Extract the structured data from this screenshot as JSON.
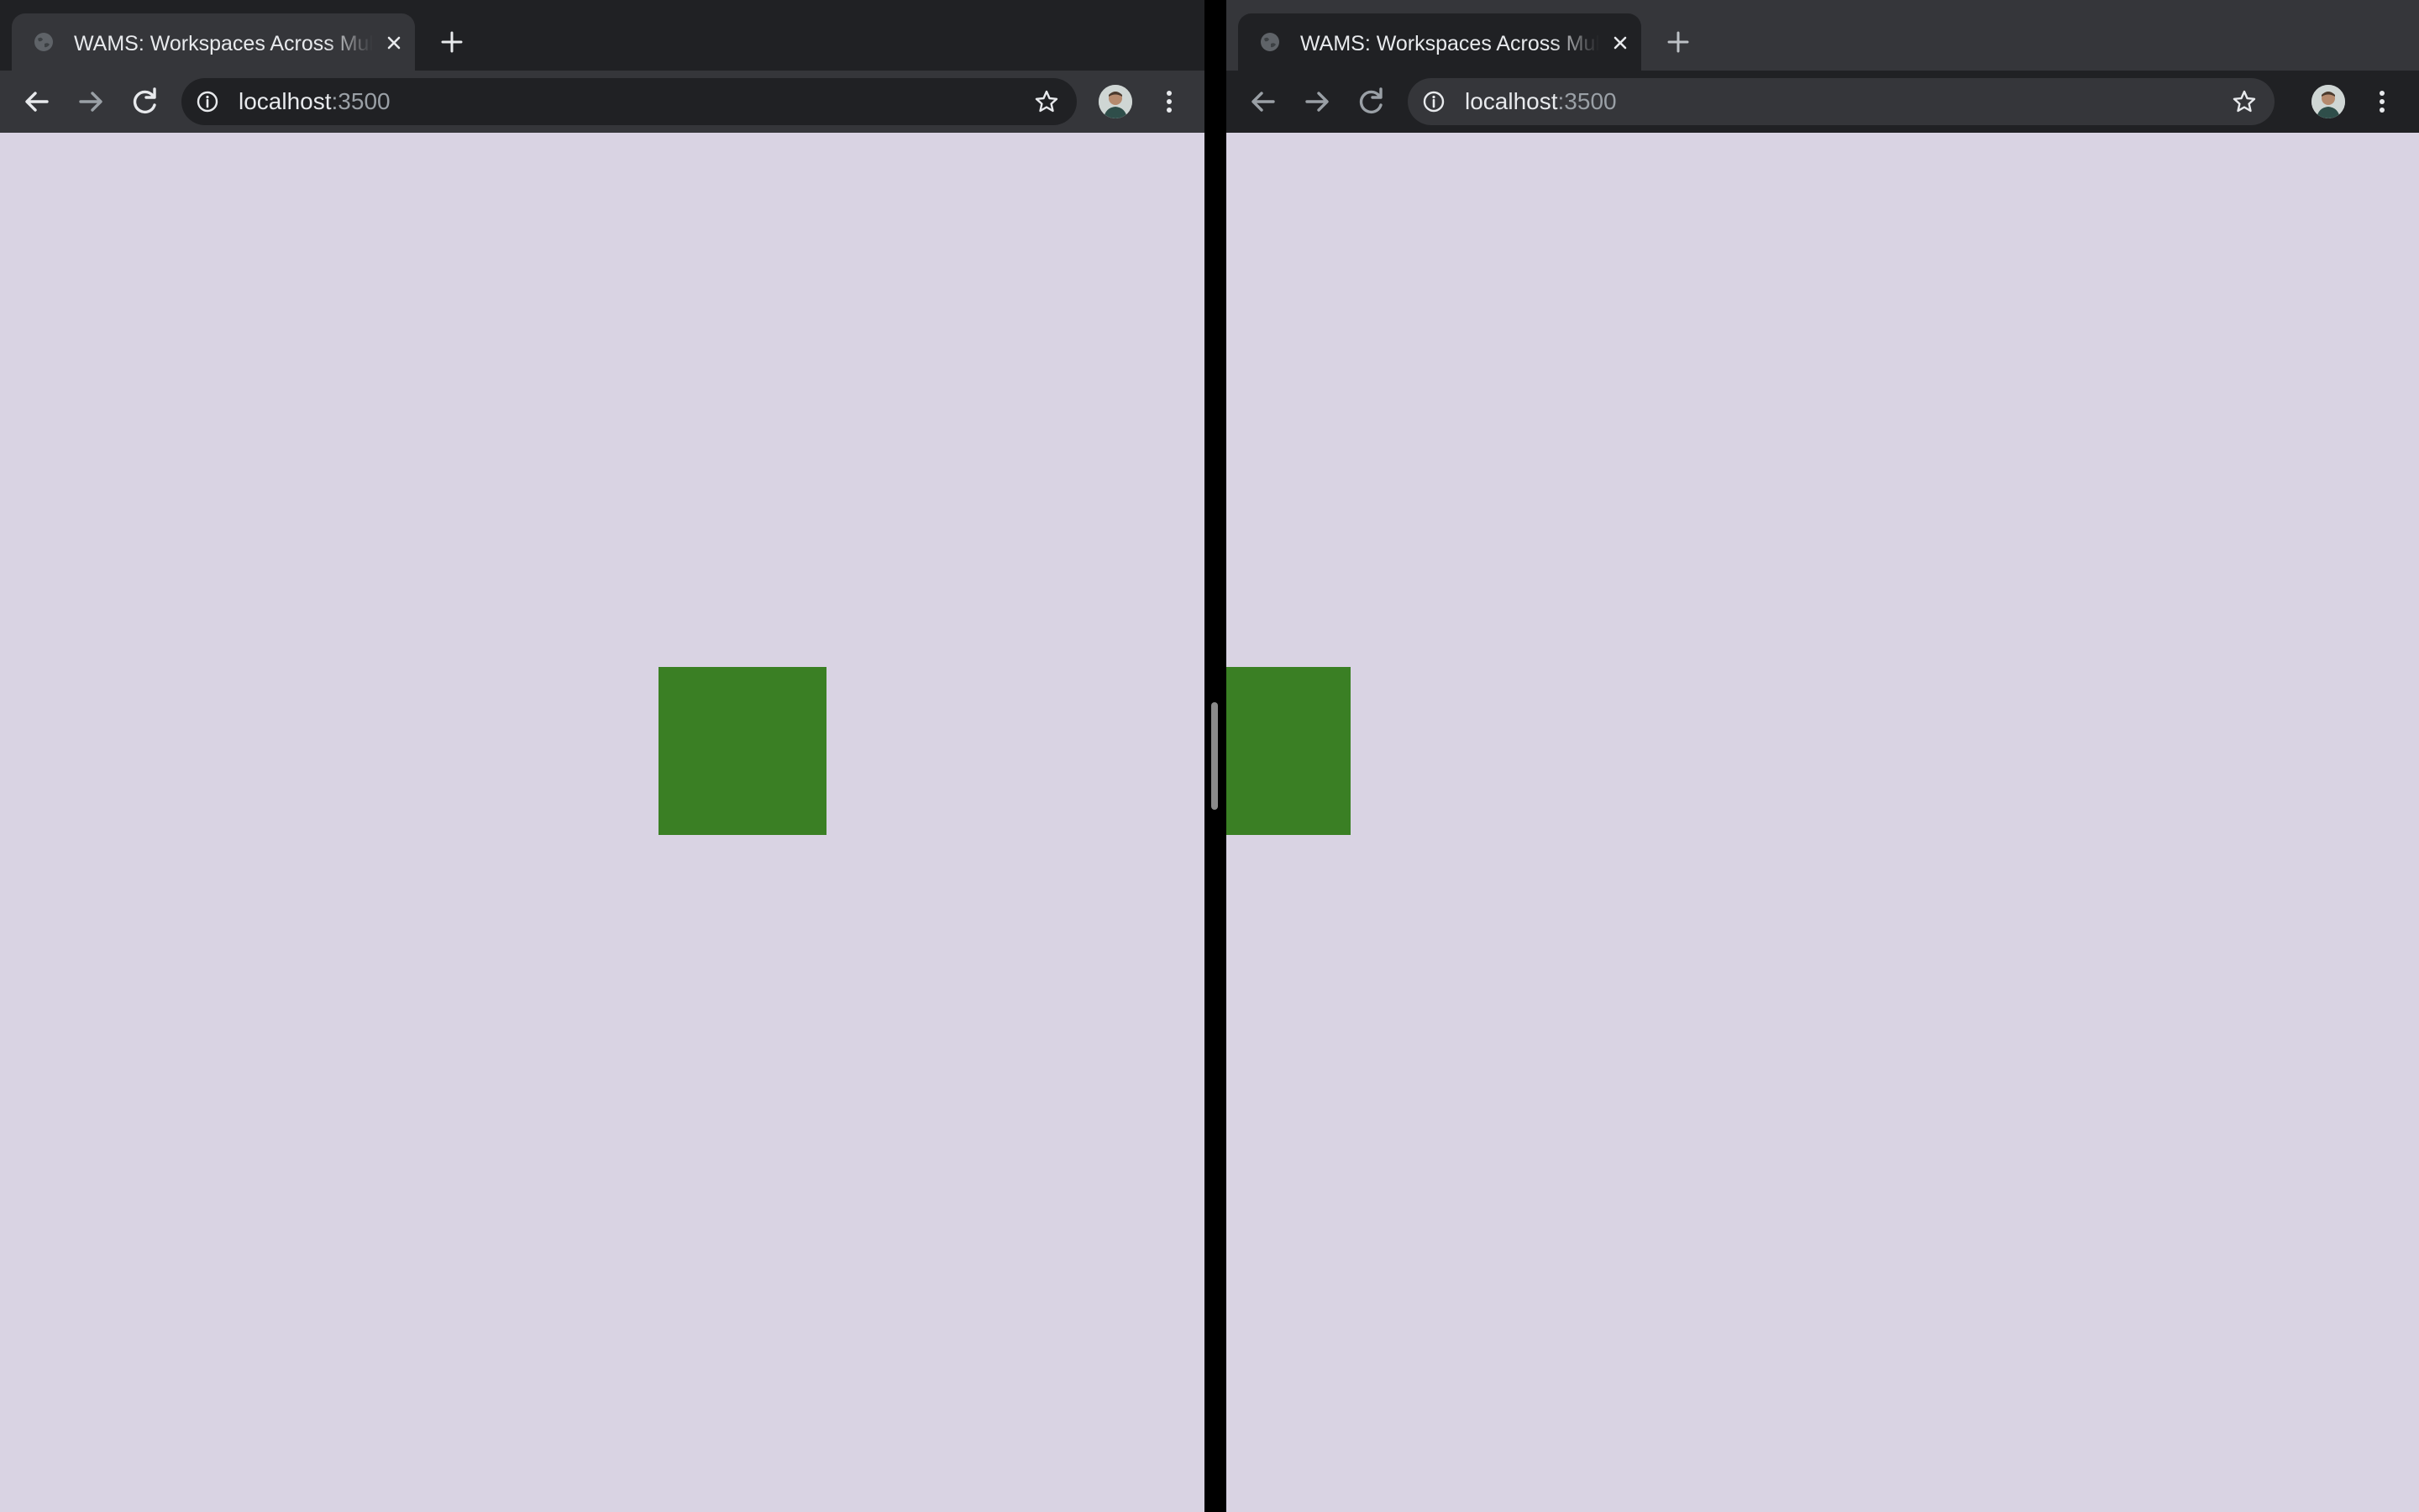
{
  "browsers": [
    {
      "tab": {
        "title": "WAMS: Workspaces Across Multiple Surfaces"
      },
      "omnibox": {
        "host": "localhost",
        "port": ":3500"
      },
      "content": {
        "square_color": "#3a7f24"
      }
    },
    {
      "tab": {
        "title": "WAMS: Workspaces Across Multiple Surfaces"
      },
      "omnibox": {
        "host": "localhost",
        "port": ":3500"
      },
      "content": {
        "square_color": "#3a7f24"
      }
    }
  ],
  "colors": {
    "page_background": "#d9d3e3",
    "tabstrip_dark": "#202124",
    "toolbar_gray": "#35363a",
    "text_light": "#e8eaed"
  },
  "icons": {
    "favicon": "globe-icon",
    "close": "close-icon",
    "new_tab": "plus-icon",
    "back": "arrow-left-icon",
    "forward": "arrow-right-icon",
    "reload": "reload-icon",
    "site_info": "info-icon",
    "bookmark": "star-icon",
    "profile": "avatar",
    "menu": "kebab-menu-icon"
  }
}
